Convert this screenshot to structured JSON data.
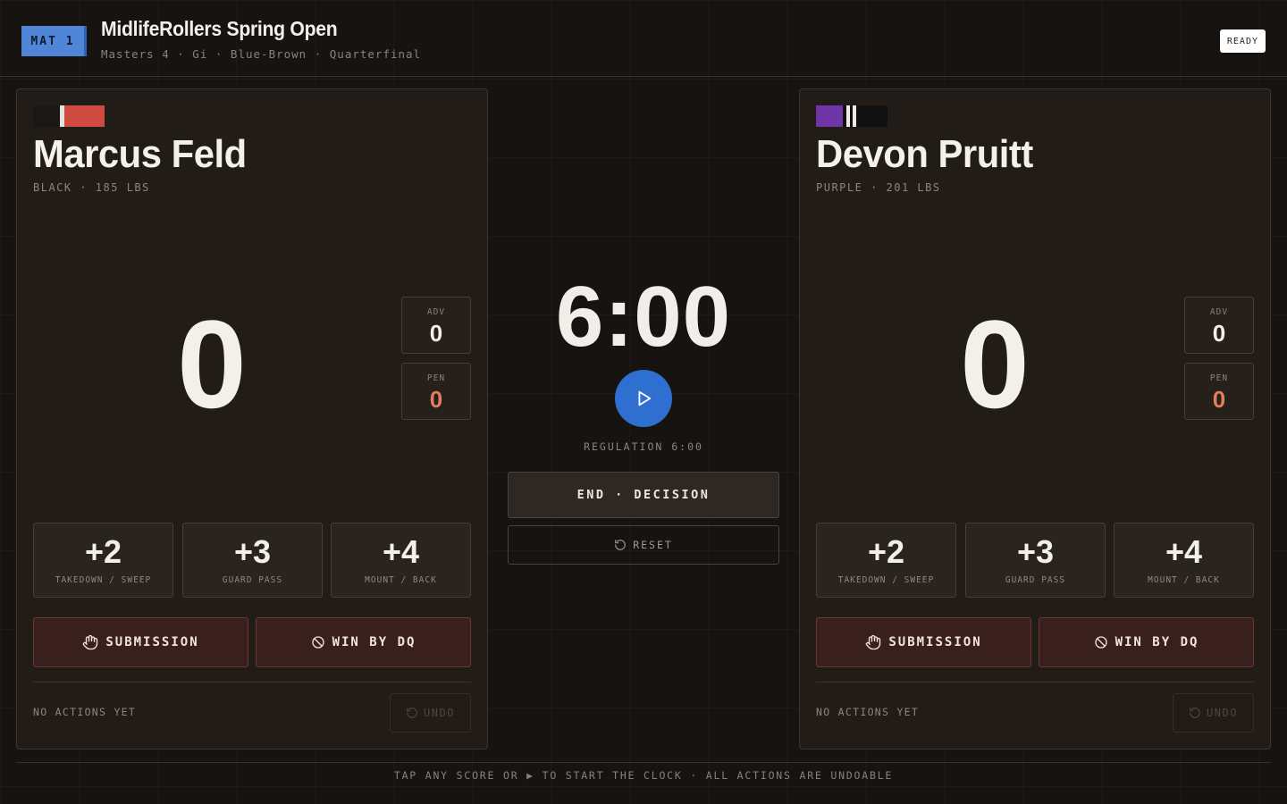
{
  "header": {
    "mat_label": "MAT 1",
    "event_title": "MidlifeRollers Spring Open",
    "event_subtitle": "Masters 4 · Gi · Blue-Brown · Quarterfinal",
    "status": "READY"
  },
  "left": {
    "name": "Marcus Feld",
    "meta": "BLACK · 185 LBS",
    "belt_colors": [
      "#1b1714",
      "#e8e2dc",
      "#cf4a40"
    ],
    "score": "0",
    "adv_label": "ADV",
    "adv_value": "0",
    "pen_label": "PEN",
    "pen_value": "0",
    "points": [
      {
        "value": "+2",
        "label": "TAKEDOWN / SWEEP"
      },
      {
        "value": "+3",
        "label": "GUARD PASS"
      },
      {
        "value": "+4",
        "label": "MOUNT / BACK"
      }
    ],
    "submission_label": "SUBMISSION",
    "dq_label": "WIN BY DQ",
    "history_empty": "NO ACTIONS YET",
    "undo_label": "UNDO"
  },
  "right": {
    "name": "Devon Pruitt",
    "meta": "PURPLE · 201 LBS",
    "belt_colors": [
      "#6e34a8",
      "#f0ebe6",
      "#111111"
    ],
    "score": "0",
    "adv_label": "ADV",
    "adv_value": "0",
    "pen_label": "PEN",
    "pen_value": "0",
    "points": [
      {
        "value": "+2",
        "label": "TAKEDOWN / SWEEP"
      },
      {
        "value": "+3",
        "label": "GUARD PASS"
      },
      {
        "value": "+4",
        "label": "MOUNT / BACK"
      }
    ],
    "submission_label": "SUBMISSION",
    "dq_label": "WIN BY DQ",
    "history_empty": "NO ACTIONS YET",
    "undo_label": "UNDO"
  },
  "center": {
    "clock": "6:00",
    "regulation": "REGULATION 6:00",
    "end_label": "END · DECISION",
    "reset_label": "RESET"
  },
  "footer": {
    "hint": "TAP ANY SCORE OR ▶ TO START THE CLOCK · ALL ACTIONS ARE UNDOABLE"
  },
  "colors": {
    "accent_blue": "#2f6fd0",
    "penalty": "#e07e5e",
    "danger_bg": "#3a201c"
  }
}
